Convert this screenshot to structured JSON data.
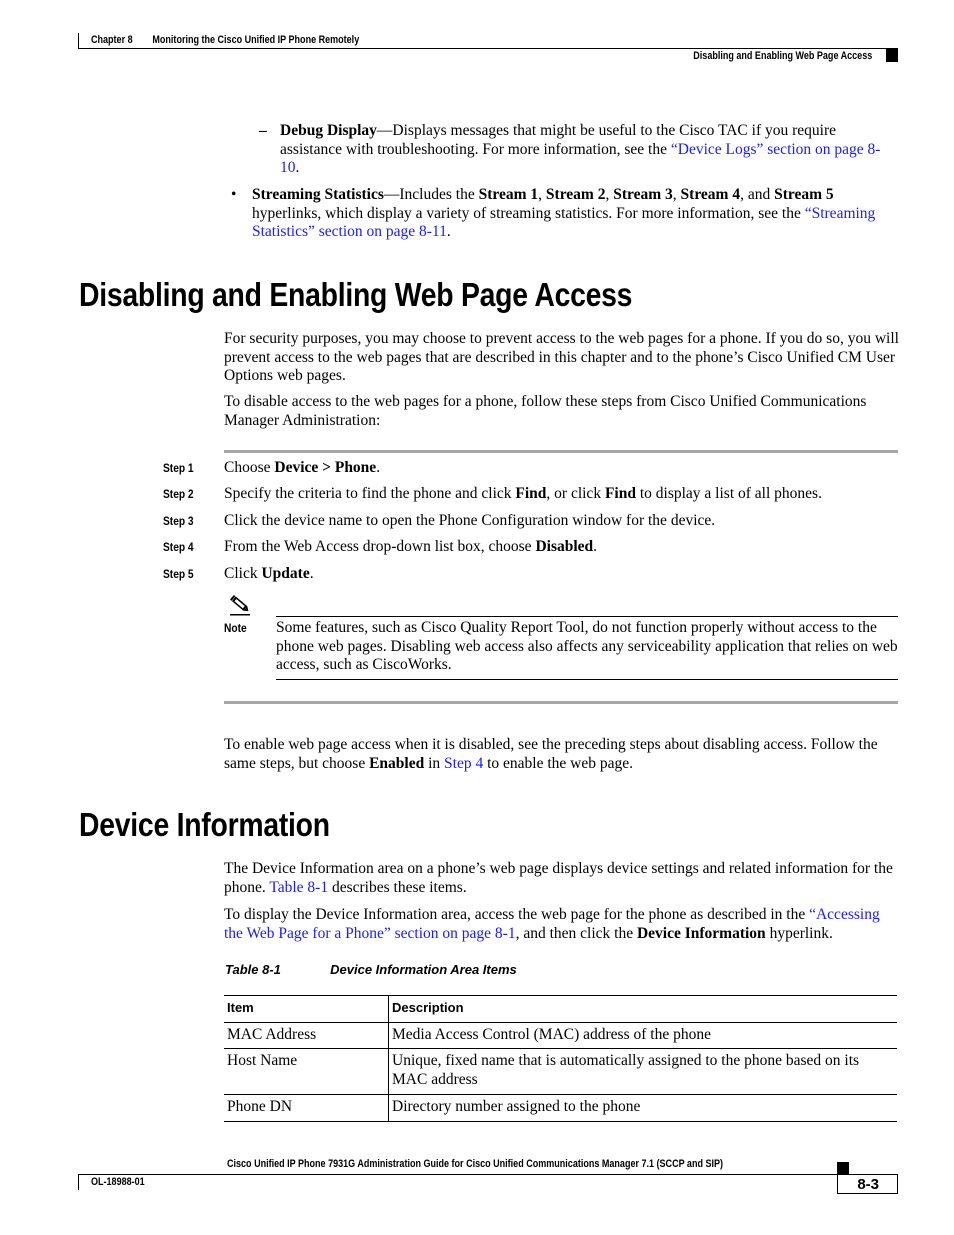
{
  "header": {
    "chapter": "Chapter 8",
    "chapter_title": "Monitoring the Cisco Unified IP Phone Remotely",
    "section": "Disabling and Enabling Web Page Access"
  },
  "intro": {
    "debug_display": {
      "bullet": "–",
      "term": "Debug Display",
      "text": "—Displays messages that might be useful to the Cisco TAC if you require assistance with troubleshooting. For more information, see the ",
      "link": "“Device Logs” section on page 8-10",
      "end": "."
    },
    "streaming": {
      "bullet": "•",
      "term": "Streaming Statistics",
      "t1": "—Includes the ",
      "s1": "Stream 1",
      "s2": "Stream 2",
      "s3": "Stream 3",
      "s4": "Stream 4",
      "s5": "Stream 5",
      "comma": ", ",
      "and": ", and ",
      "t2": " hyperlinks, which display a variety of streaming statistics. For more information, see the ",
      "link": "“Streaming Statistics” section on page 8-11",
      "end": "."
    }
  },
  "section1": {
    "title": "Disabling and Enabling Web Page Access",
    "p1": "For security purposes, you may choose to prevent access to the web pages for a phone. If you do so, you will prevent access to the web pages that are described in this chapter and to the phone’s Cisco Unified CM User Options web pages.",
    "p2": "To disable access to the web pages for a phone, follow these steps from Cisco Unified Communications Manager Administration:",
    "steps": [
      {
        "label": "Step 1",
        "pre": "Choose ",
        "bold": "Device > Phone",
        "post": "."
      },
      {
        "label": "Step 2",
        "pre": "Specify the criteria to find the phone and click ",
        "bold": "Find",
        "mid": ", or click ",
        "bold2": "Find",
        "post": " to display a list of all phones."
      },
      {
        "label": "Step 3",
        "pre": "Click the device name to open the Phone Configuration window for the device."
      },
      {
        "label": "Step 4",
        "pre": "From the Web Access drop-down list box, choose ",
        "bold": "Disabled",
        "post": "."
      },
      {
        "label": "Step 5",
        "pre": "Click ",
        "bold": "Update",
        "post": "."
      }
    ],
    "note": {
      "icon": "pencil-icon",
      "label": "Note",
      "text": "Some features, such as Cisco Quality Report Tool, do not function properly without access to the phone web pages. Disabling web access also affects any serviceability application that relies on web access, such as CiscoWorks."
    },
    "p3": {
      "pre": "To enable web page access when it is disabled, see the preceding steps about disabling access. Follow the same steps, but choose ",
      "bold": "Enabled",
      "mid": " in ",
      "link": "Step 4",
      "post": " to enable the web page."
    }
  },
  "section2": {
    "title": "Device Information",
    "p1": {
      "pre": "The Device Information area on a phone’s web page displays device settings and related information for the phone. ",
      "link": "Table 8-1",
      "post": " describes these items."
    },
    "p2": {
      "pre": "To display the Device Information area, access the web page for the phone as described in the ",
      "link": "“Accessing the Web Page for a Phone” section on page 8-1",
      "mid": ", and then click the ",
      "bold": "Device Information",
      "post": " hyperlink."
    },
    "table": {
      "number": "Table 8-1",
      "caption": "Device Information Area Items",
      "columns": [
        "Item",
        "Description"
      ],
      "rows": [
        [
          "MAC Address",
          "Media Access Control (MAC) address of the phone"
        ],
        [
          "Host Name",
          "Unique, fixed name that is automatically assigned to the phone based on its MAC address"
        ],
        [
          "Phone DN",
          "Directory number assigned to the phone"
        ]
      ]
    }
  },
  "footer": {
    "guide_title": "Cisco Unified IP Phone 7931G Administration Guide for Cisco Unified Communications Manager 7.1 (SCCP and SIP)",
    "doc_number": "OL-18988-01",
    "page": "8-3"
  },
  "colors": {
    "link": "#1a1aff",
    "rule_gray": "#a6a6a6"
  }
}
